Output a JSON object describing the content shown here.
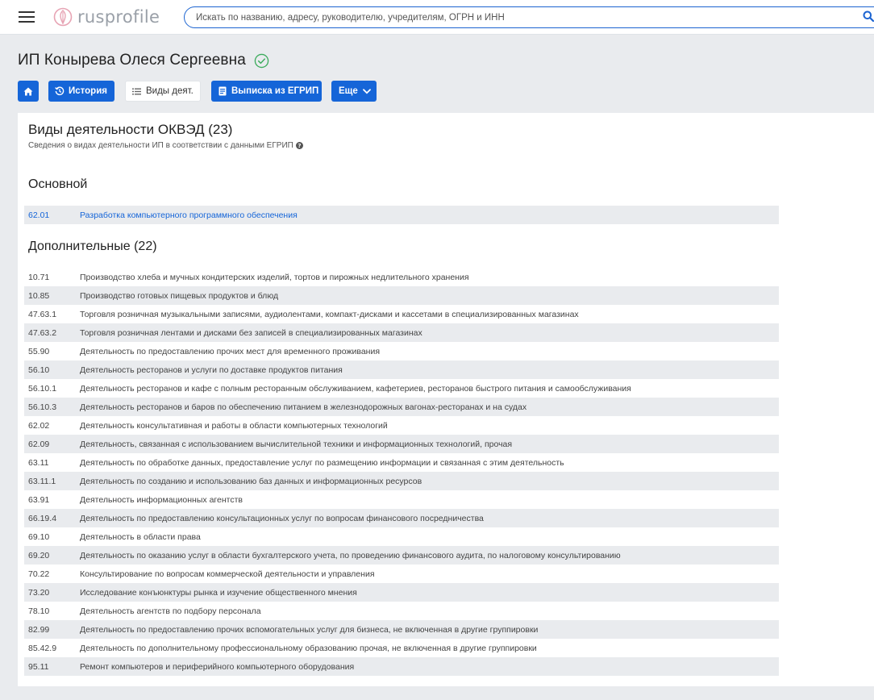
{
  "header": {
    "logo_text": "rusprofile",
    "search_placeholder": "Искать по названию, адресу, руководителю, учредителям, ОГРН и ИНН"
  },
  "page": {
    "title": "ИП Конырева Олеся Сергеевна"
  },
  "toolbar": {
    "history_label": "История",
    "kinds_label": "Виды деят.",
    "extract_label": "Выписка из ЕГРИП",
    "more_label": "Еще"
  },
  "card": {
    "title": "Виды деятельности ОКВЭД (23)",
    "subtitle": "Сведения о видах деятельности ИП в соответствии с данными ЕГРИП",
    "main_section_title": "Основной",
    "extra_section_title": "Дополнительные (22)"
  },
  "main_activity": {
    "code": "62.01",
    "desc": "Разработка компьютерного программного обеспечения"
  },
  "extra_activities": [
    {
      "code": "10.71",
      "desc": "Производство хлеба и мучных кондитерских изделий, тортов и пирожных недлительного хранения"
    },
    {
      "code": "10.85",
      "desc": "Производство готовых пищевых продуктов и блюд"
    },
    {
      "code": "47.63.1",
      "desc": "Торговля розничная музыкальными записями, аудиолентами, компакт-дисками и кассетами в специализированных магазинах"
    },
    {
      "code": "47.63.2",
      "desc": "Торговля розничная лентами и дисками без записей в специализированных магазинах"
    },
    {
      "code": "55.90",
      "desc": "Деятельность по предоставлению прочих мест для временного проживания"
    },
    {
      "code": "56.10",
      "desc": "Деятельность ресторанов и услуги по доставке продуктов питания"
    },
    {
      "code": "56.10.1",
      "desc": "Деятельность ресторанов и кафе с полным ресторанным обслуживанием, кафетериев, ресторанов быстрого питания и самообслуживания"
    },
    {
      "code": "56.10.3",
      "desc": "Деятельность ресторанов и баров по обеспечению питанием в железнодорожных вагонах-ресторанах и на судах"
    },
    {
      "code": "62.02",
      "desc": "Деятельность консультативная и работы в области компьютерных технологий"
    },
    {
      "code": "62.09",
      "desc": "Деятельность, связанная с использованием вычислительной техники и информационных технологий, прочая"
    },
    {
      "code": "63.11",
      "desc": "Деятельность по обработке данных, предоставление услуг по размещению информации и связанная с этим деятельность"
    },
    {
      "code": "63.11.1",
      "desc": "Деятельность по созданию и использованию баз данных и информационных ресурсов"
    },
    {
      "code": "63.91",
      "desc": "Деятельность информационных агентств"
    },
    {
      "code": "66.19.4",
      "desc": "Деятельность по предоставлению консультационных услуг по вопросам финансового посредничества"
    },
    {
      "code": "69.10",
      "desc": "Деятельность в области права"
    },
    {
      "code": "69.20",
      "desc": "Деятельность по оказанию услуг в области бухгалтерского учета, по проведению финансового аудита, по налоговому консультированию"
    },
    {
      "code": "70.22",
      "desc": "Консультирование по вопросам коммерческой деятельности и управления"
    },
    {
      "code": "73.20",
      "desc": "Исследование конъюнктуры рынка и изучение общественного мнения"
    },
    {
      "code": "78.10",
      "desc": "Деятельность агентств по подбору персонала"
    },
    {
      "code": "82.99",
      "desc": "Деятельность по предоставлению прочих вспомогательных услуг для бизнеса, не включенная в другие группировки"
    },
    {
      "code": "85.42.9",
      "desc": "Деятельность по дополнительному профессиональному образованию прочая, не включенная в другие группировки"
    },
    {
      "code": "95.11",
      "desc": "Ремонт компьютеров и периферийного компьютерного оборудования"
    }
  ],
  "colors": {
    "accent": "#1565d8",
    "background": "#e9ebee",
    "row_shade": "#e9ebee",
    "verified": "#3cab5c"
  },
  "icons": {
    "menu": "burger-menu-icon",
    "logo": "rusprofile-logo-icon",
    "search": "search-icon",
    "verified": "check-circle-icon",
    "home": "home-icon",
    "history": "history-icon",
    "kinds": "list-icon",
    "extract": "document-icon",
    "more": "chevron-down-icon",
    "help": "question-circle-icon"
  }
}
